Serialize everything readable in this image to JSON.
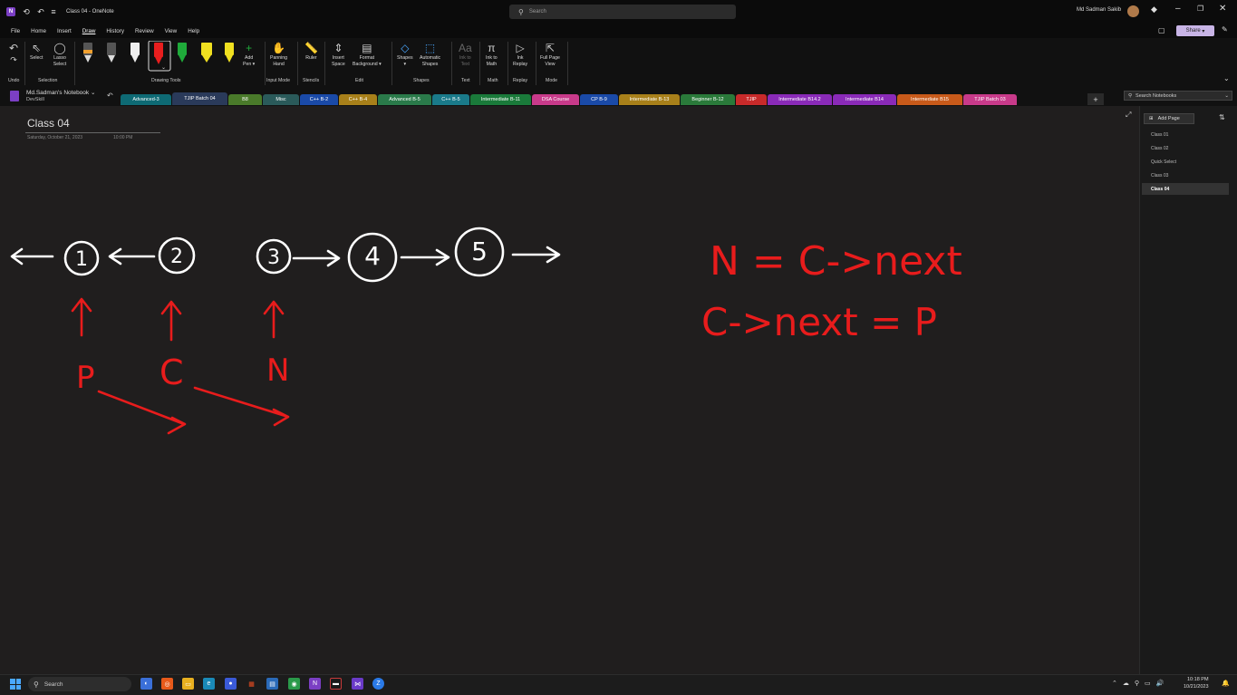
{
  "window": {
    "title": "Class 04  -  OneNote",
    "search_placeholder": "Search",
    "user_name": "Md Sadman Sakib",
    "app_icon": "N"
  },
  "menu": [
    "File",
    "Home",
    "Insert",
    "Draw",
    "History",
    "Review",
    "View",
    "Help"
  ],
  "share_label": "Share",
  "ribbon": {
    "undo_group": "Undo",
    "select": "Select",
    "lasso": "Lasso\nSelect",
    "selection_group": "Selection",
    "drawing_tools_group": "Drawing Tools",
    "add_pen": "Add\nPen",
    "panning_hand": "Panning\nHand",
    "input_mode_group": "Input Mode",
    "ruler": "Ruler",
    "stencils_group": "Stencils",
    "insert_space": "Insert\nSpace",
    "format_background": "Format\nBackground",
    "edit_group": "Edit",
    "shapes": "Shapes",
    "automatic_shapes": "Automatic\nShapes",
    "shapes_group": "Shapes",
    "ink_to_text": "Ink to\nText",
    "text_group": "Text",
    "ink_to_math": "Ink to\nMath",
    "math_group": "Math",
    "ink_replay": "Ink\nReplay",
    "replay_group": "Replay",
    "full_page_view": "Full Page\nView",
    "mode_group": "Mode",
    "pen_colors": [
      "#444444",
      "#e8e8e8",
      "#f5f5f5",
      "#e81e1e",
      "#1faa3a",
      "#f0e020",
      "#f0e020"
    ]
  },
  "notebook": {
    "name": "Md.Sadman's Notebook",
    "sub": "DevSkill"
  },
  "section_tabs": [
    {
      "label": "Advanced-3",
      "color": "#0e6a74"
    },
    {
      "label": "TJIP Batch 04",
      "color": "#2a3a5a"
    },
    {
      "label": "B8",
      "color": "#4a7a2a"
    },
    {
      "label": "Misc",
      "color": "#2a5a5a"
    },
    {
      "label": "C++ B-2",
      "color": "#1a4aa8"
    },
    {
      "label": "C++ B-4",
      "color": "#a8801a"
    },
    {
      "label": "Advanced B-5",
      "color": "#2a7a4a"
    },
    {
      "label": "C++ B-5",
      "color": "#1a7a8a"
    },
    {
      "label": "Intermediate B-11",
      "color": "#1a7a3a"
    },
    {
      "label": "DSA Course",
      "color": "#c83a8a"
    },
    {
      "label": "CP B-9",
      "color": "#1a4aa8"
    },
    {
      "label": "Intermediate B-13",
      "color": "#a8801a"
    },
    {
      "label": "Beginner B-12",
      "color": "#2a7a3a"
    },
    {
      "label": "TJIP",
      "color": "#c82a2a"
    },
    {
      "label": "Intermediate B14.2",
      "color": "#8a2ab8"
    },
    {
      "label": "Intermediate B14",
      "color": "#8a2ab8"
    },
    {
      "label": "Intermediate B15",
      "color": "#c85a1a"
    },
    {
      "label": "TJIP Batch 03",
      "color": "#c83a8a"
    }
  ],
  "notebook_search_placeholder": "Search Notebooks",
  "page": {
    "title": "Class 04",
    "date": "Saturday, October 21, 2023",
    "time": "10:00 PM"
  },
  "add_page_label": "Add Page",
  "pages": [
    "Class 01",
    "Class 02",
    "Quick Select",
    "Class 03",
    "Class 04"
  ],
  "selected_page_index": 4,
  "ink": {
    "nodes": [
      "1",
      "2",
      "3",
      "4",
      "5"
    ],
    "pointer_labels": [
      "P",
      "C",
      "N"
    ],
    "formula_1": "N = C->next",
    "formula_2": "C->next = P",
    "ink_colors": {
      "white": "#ffffff",
      "red": "#e81c1c"
    }
  },
  "taskbar": {
    "search_placeholder": "Search",
    "time": "10:18 PM",
    "date": "10/21/2023"
  }
}
